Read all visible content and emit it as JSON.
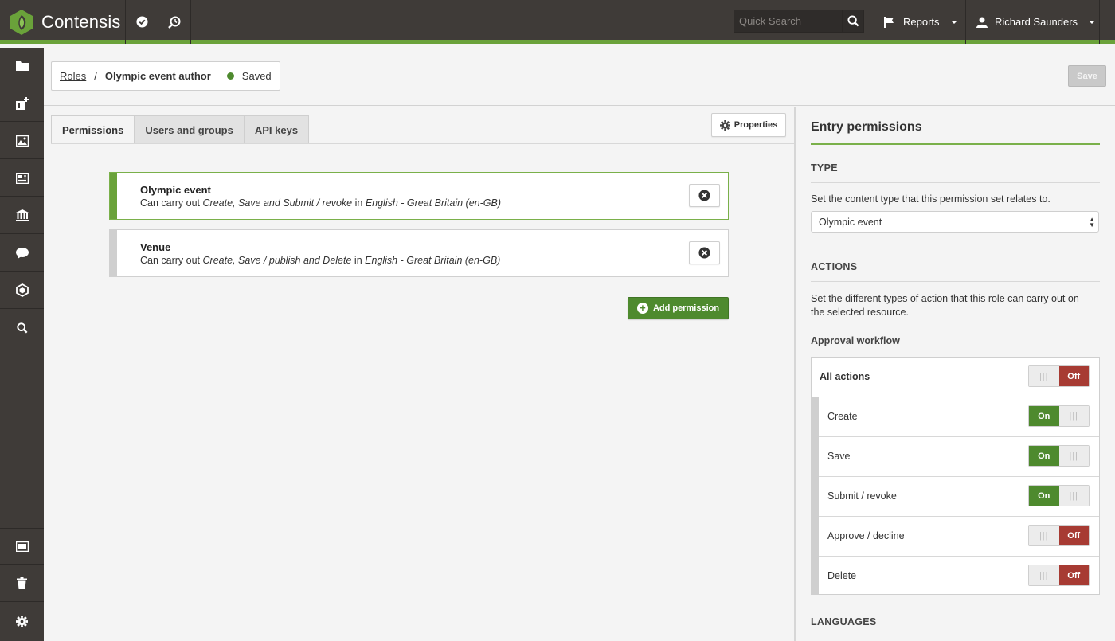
{
  "app": {
    "brand": "Contensis"
  },
  "topbar": {
    "search_placeholder": "Quick Search",
    "reports_label": "Reports",
    "user_name": "Richard Saunders"
  },
  "breadcrumb": {
    "parent": "Roles",
    "separator": "/",
    "current": "Olympic event author",
    "status": "Saved"
  },
  "header": {
    "save_label": "Save"
  },
  "tabs": [
    {
      "label": "Permissions",
      "active": true
    },
    {
      "label": "Users and groups",
      "active": false
    },
    {
      "label": "API keys",
      "active": false
    }
  ],
  "properties_label": "Properties",
  "permissions": [
    {
      "title": "Olympic event",
      "prefix": "Can carry out ",
      "actions": "Create, Save and Submit / revoke",
      "mid": " in ",
      "language": "English - Great Britain (en-GB)"
    },
    {
      "title": "Venue",
      "prefix": "Can carry out ",
      "actions": "Create, Save / publish and Delete",
      "mid": " in ",
      "language": "English - Great Britain (en-GB)"
    }
  ],
  "add_permission_label": "Add permission",
  "panel": {
    "title": "Entry permissions",
    "type_heading": "TYPE",
    "type_help": "Set the content type that this permission set relates to.",
    "type_value": "Olympic event",
    "actions_heading": "ACTIONS",
    "actions_help": "Set the different types of action that this role can carry out on the selected resource.",
    "workflow_label": "Approval workflow",
    "languages_heading": "LANGUAGES",
    "on_label": "On",
    "off_label": "Off",
    "handle_glyph": "|||",
    "toggles": [
      {
        "label": "All actions",
        "state": "off"
      },
      {
        "label": "Create",
        "state": "on"
      },
      {
        "label": "Save",
        "state": "on"
      },
      {
        "label": "Submit / revoke",
        "state": "on"
      },
      {
        "label": "Approve / decline",
        "state": "off"
      },
      {
        "label": "Delete",
        "state": "off"
      }
    ]
  },
  "colors": {
    "accent_green": "#6aa23a",
    "on_green": "#4e8a2e",
    "off_red": "#a73b33",
    "chrome_dark": "#3f3b38"
  }
}
